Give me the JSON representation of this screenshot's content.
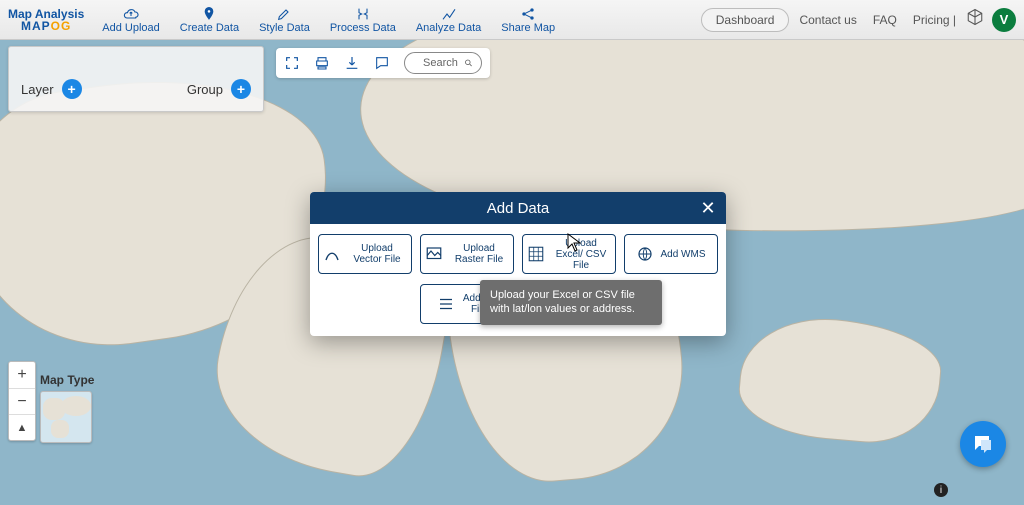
{
  "brand": {
    "top": "Map Analysis",
    "bot_a": "MAP",
    "bot_b": "OG"
  },
  "toolbar": {
    "add_upload": "Add Upload",
    "create_data": "Create Data",
    "style_data": "Style Data",
    "process_data": "Process Data",
    "analyze_data": "Analyze Data",
    "share_map": "Share Map"
  },
  "topright": {
    "dashboard": "Dashboard",
    "contact": "Contact us",
    "faq": "FAQ",
    "pricing": "Pricing |",
    "avatar_initial": "V"
  },
  "layer_panel": {
    "layer": "Layer",
    "group": "Group"
  },
  "map_tools": {
    "search_placeholder": "Search"
  },
  "map_type_label": "Map Type",
  "zoom": {
    "in": "+",
    "out": "−",
    "north": "▲"
  },
  "modal": {
    "title": "Add Data",
    "options": {
      "vector": "Upload Vector File",
      "raster": "Upload Raster File",
      "excel": "Upload Excel/ CSV File",
      "wms": "Add WMS",
      "excel_partial": "Add Ex\nFile"
    },
    "tooltip": "Upload your Excel or CSV file with lat/lon values or address."
  },
  "info_glyph": "i"
}
